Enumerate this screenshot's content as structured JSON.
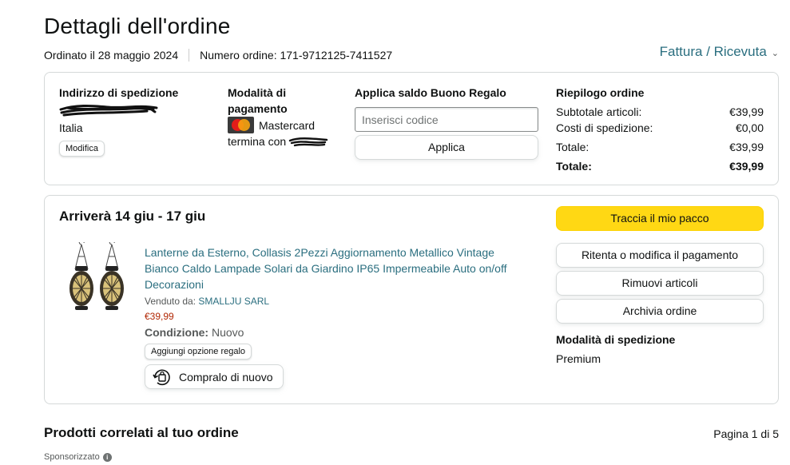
{
  "page": {
    "title": "Dettagli dell'ordine",
    "ordered_on": "Ordinato il 28 maggio 2024",
    "order_number": "Numero ordine: 171-9712125-7411527",
    "invoice_link": "Fattura / Ricevuta"
  },
  "shipping_address": {
    "heading": "Indirizzo di spedizione",
    "country": "Italia",
    "edit_button": "Modifica"
  },
  "payment": {
    "heading": "Modalità di pagamento",
    "card_brand": "Mastercard",
    "card_ending_label": "termina con"
  },
  "gift_card": {
    "heading": "Applica saldo Buono Regalo",
    "input_placeholder": "Inserisci codice",
    "input_value": "",
    "apply_button": "Applica"
  },
  "order_summary": {
    "heading": "Riepilogo ordine",
    "rows": [
      {
        "label": "Subtotale articoli:",
        "value": "€39,99"
      },
      {
        "label": "Costi di spedizione:",
        "value": "€0,00"
      },
      {
        "label": "Totale:",
        "value": "€39,99"
      },
      {
        "label": "Totale:",
        "value": "€39,99"
      }
    ]
  },
  "shipment": {
    "arrival": "Arriverà 14 giu - 17 giu",
    "product": {
      "title": "Lanterne da Esterno, Collasis 2Pezzi Aggiornamento Metallico Vintage Bianco Caldo Lampade Solari da Giardino IP65 Impermeabile Auto on/off Decorazioni",
      "sold_by_label": "Venduto da:",
      "seller": "SMALLJU SARL",
      "price": "€39,99",
      "condition_label": "Condizione:",
      "condition_value": "Nuovo",
      "gift_option_button": "Aggiungi opzione regalo",
      "buy_again_button": "Compralo di nuovo"
    },
    "actions": {
      "track": "Traccia il mio pacco",
      "retry_payment": "Ritenta o modifica il pagamento",
      "remove_items": "Rimuovi articoli",
      "archive": "Archivia ordine"
    },
    "shipping_method_heading": "Modalità di spedizione",
    "shipping_method_value": "Premium"
  },
  "related": {
    "title": "Prodotti correlati al tuo ordine",
    "pagination": "Pagina 1 di 5",
    "sponsored": "Sponsorizzato"
  },
  "colors": {
    "link": "#2a6e7f",
    "track_button": "#ffd814",
    "price": "#b12704",
    "border": "#d5d9d9"
  }
}
